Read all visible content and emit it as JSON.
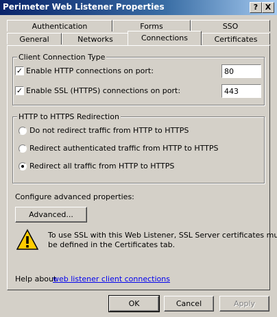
{
  "window": {
    "title": "Perimeter Web Listener Properties",
    "help_btn": "?",
    "close_btn": "X"
  },
  "tabs": {
    "row1": [
      "Authentication",
      "Forms",
      "SSO"
    ],
    "row2": [
      "General",
      "Networks",
      "Connections",
      "Certificates"
    ],
    "active": "Connections"
  },
  "client_connection": {
    "group_label": "Client Connection Type",
    "http_label": "Enable HTTP connections on port:",
    "http_checked": true,
    "http_port": "80",
    "ssl_label": "Enable SSL (HTTPS) connections on port:",
    "ssl_checked": true,
    "ssl_port": "443"
  },
  "redirection": {
    "group_label": "HTTP to HTTPS Redirection",
    "options": [
      "Do not redirect traffic from HTTP to HTTPS",
      "Redirect authenticated traffic from HTTP to HTTPS",
      "Redirect all traffic from HTTP to HTTPS"
    ],
    "selected_index": 2
  },
  "advanced": {
    "label": "Configure advanced properties:",
    "button": "Advanced..."
  },
  "warning": {
    "text_line1": "To use SSL with this Web Listener, SSL Server certificates must",
    "text_line2": "be defined in the Certificates tab."
  },
  "help": {
    "prefix": "Help about ",
    "link": "web listener client connections"
  },
  "footer": {
    "ok": "OK",
    "cancel": "Cancel",
    "apply": "Apply"
  }
}
